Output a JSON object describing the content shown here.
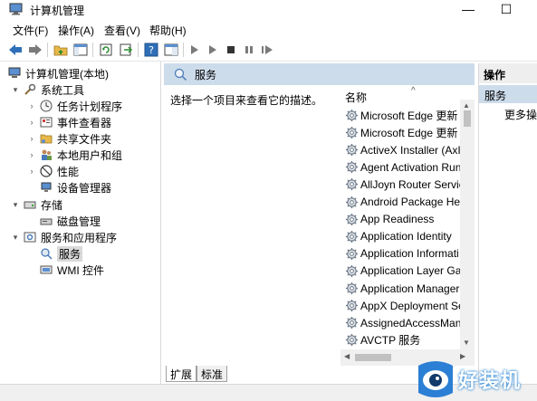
{
  "window": {
    "title": "计算机管理",
    "min_glyph": "—",
    "max_glyph": "☐"
  },
  "menu": [
    "文件(F)",
    "操作(A)",
    "查看(V)",
    "帮助(H)"
  ],
  "tree": {
    "root": "计算机管理(本地)",
    "system_tools": "系统工具",
    "task_scheduler": "任务计划程序",
    "event_viewer": "事件查看器",
    "shared_folders": "共享文件夹",
    "local_users": "本地用户和组",
    "performance": "性能",
    "device_manager": "设备管理器",
    "storage": "存储",
    "disk_management": "磁盘管理",
    "services_apps": "服务和应用程序",
    "services": "服务",
    "wmi": "WMI 控件"
  },
  "center": {
    "header": "服务",
    "description": "选择一个项目来查看它的描述。",
    "column_name": "名称",
    "services": [
      "Microsoft Edge 更新",
      "Microsoft Edge 更新",
      "ActiveX Installer (AxIr",
      "Agent Activation Runt",
      "AllJoyn Router Servic",
      "Android Package He",
      "App Readiness",
      "Application Identity",
      "Application Informati",
      "Application Layer Ga",
      "Application Manager",
      "AppX Deployment Se",
      "AssignedAccessMana",
      "AVCTP 服务"
    ],
    "tabs": [
      "扩展",
      "标准"
    ]
  },
  "actions": {
    "header": "操作",
    "section": "服务",
    "more": "更多操..."
  },
  "watermark": {
    "text": "好装机"
  },
  "colors": {
    "header_blue": "#cddceb",
    "selection_gray": "#d9d9d9",
    "watermark_blue": "#2b7fd4"
  }
}
